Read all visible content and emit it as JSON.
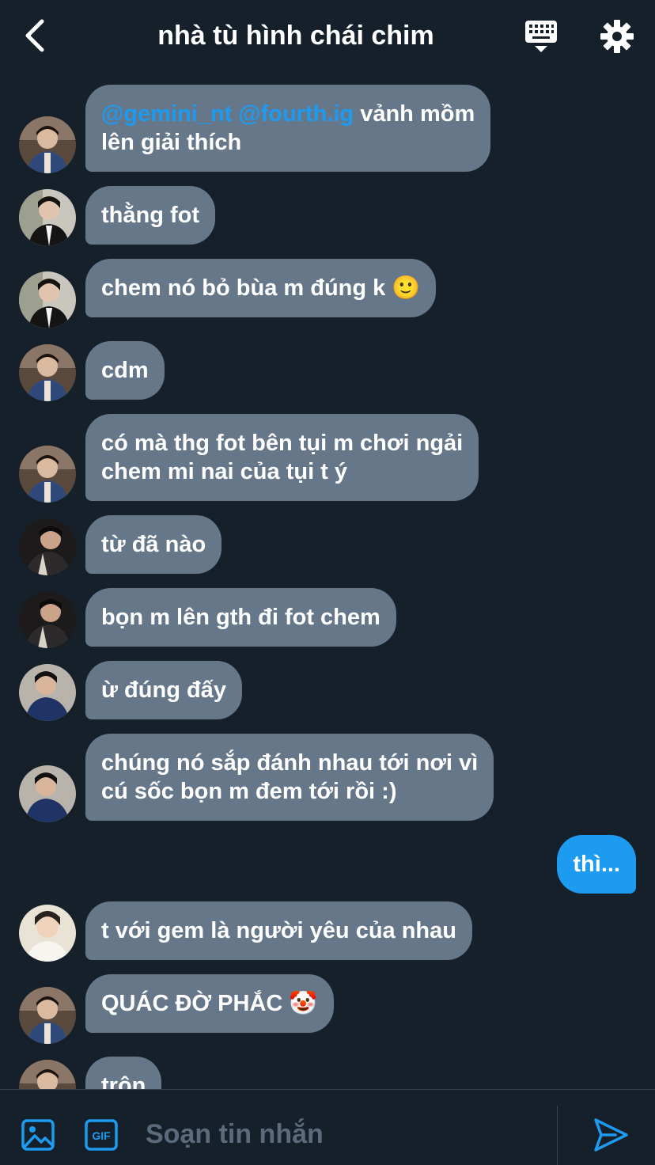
{
  "header": {
    "title": "nhà tù hình chái chim",
    "back_icon": "chevron-left-icon",
    "keyboard_icon": "keyboard-icon",
    "settings_icon": "gear-icon"
  },
  "messages": [
    {
      "prefix_mentions": "@gemini_nt @fourth.ig",
      "text_line1": " vảnh mồm",
      "text_line2": "lên giải thích",
      "avatar": "avatar-a"
    },
    {
      "text": "thằng fot",
      "avatar": "avatar-b"
    },
    {
      "text": "chem nó bỏ bùa m đúng k 🙂",
      "avatar": "avatar-b"
    },
    {
      "text": "cdm",
      "avatar": "avatar-a"
    },
    {
      "text_line1": "có mà thg fot bên tụi m chơi ngải",
      "text_line2": "chem mi nai của tụi t ý",
      "avatar": "avatar-a"
    },
    {
      "text": "từ đã nào",
      "avatar": "avatar-c"
    },
    {
      "text": "bọn m lên gth đi fot chem",
      "avatar": "avatar-c"
    },
    {
      "text": "ừ đúng đấy",
      "avatar": "avatar-d"
    },
    {
      "text_line1": "chúng nó sắp đánh nhau tới nơi vì",
      "text_line2": "cú sốc bọn m đem tới rồi :)",
      "avatar": "avatar-d"
    },
    {
      "text": "thì...",
      "mine": true
    },
    {
      "text": "t với gem là người yêu của nhau",
      "avatar": "avatar-e"
    },
    {
      "text": "QUÁC ĐỜ PHẮC 🤡",
      "avatar": "avatar-a"
    },
    {
      "text": "trộn",
      "avatar": "avatar-a"
    }
  ],
  "composer": {
    "placeholder": "Soạn tin nhắn",
    "image_icon": "image-icon",
    "gif_icon": "gif-icon",
    "gif_label": "GIF",
    "send_icon": "send-icon"
  },
  "colors": {
    "background": "#15202b",
    "bubble_other": "#66778a",
    "bubble_mine": "#1d9bf0",
    "mention": "#1d9bf0",
    "accent": "#1d9bf0"
  }
}
